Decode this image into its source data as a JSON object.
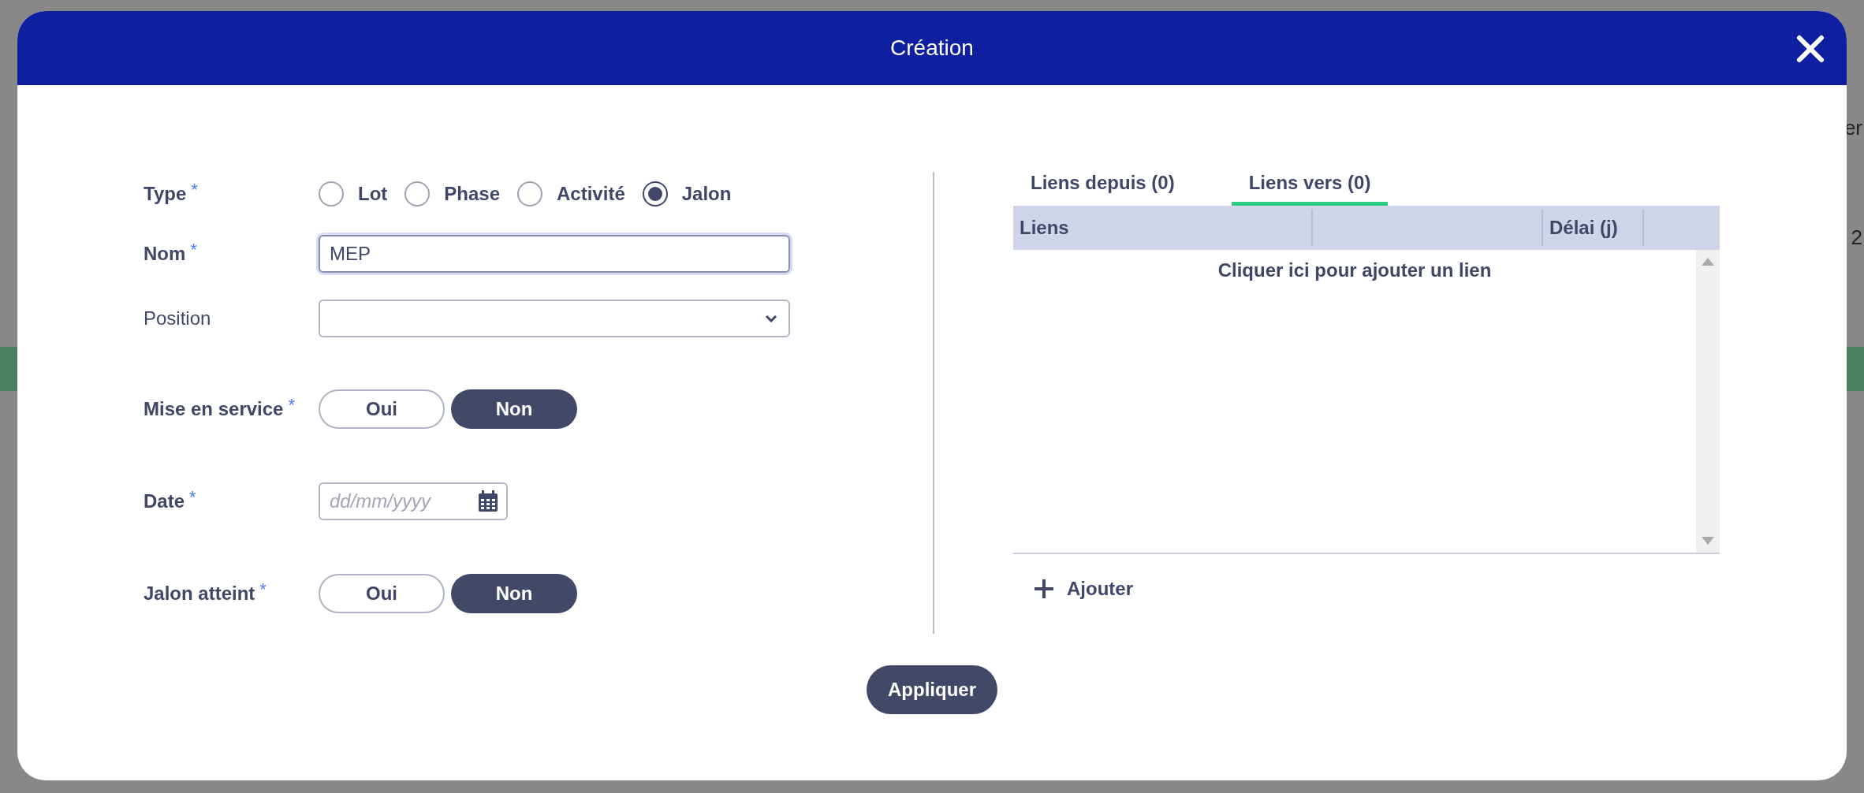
{
  "backdrop": {
    "right_texts": [
      "er",
      "2"
    ]
  },
  "dialog": {
    "title": "Création"
  },
  "form": {
    "type": {
      "label": "Type",
      "required_mark": "*",
      "options": [
        {
          "label": "Lot",
          "selected": false
        },
        {
          "label": "Phase",
          "selected": false
        },
        {
          "label": "Activité",
          "selected": false
        },
        {
          "label": "Jalon",
          "selected": true
        }
      ]
    },
    "name": {
      "label": "Nom",
      "required_mark": "*",
      "value": "MEP"
    },
    "position": {
      "label": "Position"
    },
    "commissioning": {
      "label": "Mise en service",
      "required_mark": "*",
      "options": [
        {
          "label": "Oui",
          "selected": false
        },
        {
          "label": "Non",
          "selected": true
        }
      ]
    },
    "date": {
      "label": "Date",
      "required_mark": "*",
      "placeholder": "dd/mm/yyyy"
    },
    "milestone_reached": {
      "label": "Jalon atteint",
      "required_mark": "*",
      "options": [
        {
          "label": "Oui",
          "selected": false
        },
        {
          "label": "Non",
          "selected": true
        }
      ]
    }
  },
  "links": {
    "tabs": [
      {
        "label": "Liens depuis (0)",
        "selected": false
      },
      {
        "label": "Liens vers (0)",
        "selected": true
      }
    ],
    "table": {
      "columns": [
        "Liens",
        "Délai (j)"
      ],
      "empty_message": "Cliquer ici pour ajouter un lien"
    },
    "add_button": "Ajouter"
  },
  "apply_button": "Appliquer"
}
